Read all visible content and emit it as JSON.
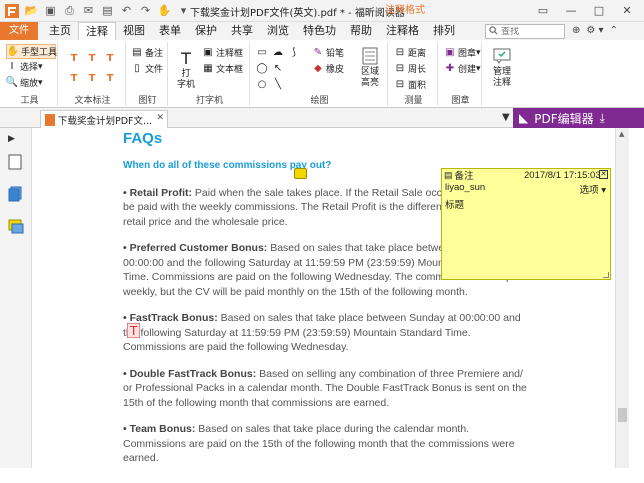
{
  "titlebar": {
    "title": "下载奖金计划PDF文件(英文).pdf * - 福昕阅读器",
    "context_tab": "注释格式"
  },
  "tabs": {
    "file": "文件",
    "items": [
      "主页",
      "注释",
      "视图",
      "表单",
      "保护",
      "共享",
      "浏览",
      "特色功",
      "帮助",
      "注释格",
      "排列"
    ],
    "active": "注释"
  },
  "search": {
    "placeholder": "查找"
  },
  "ribbon": {
    "tools": {
      "hand": "手型工具",
      "select": "选择",
      "zoom": "缩放",
      "group": "工具"
    },
    "textmark": {
      "group": "文本标注"
    },
    "pin": {
      "note": "备注",
      "file": "文件",
      "group": "图钉"
    },
    "typewriter": {
      "big": "打\n字机",
      "comment_box": "注释框",
      "text_box": "文本框",
      "group": "打字机"
    },
    "drawing": {
      "pencil": "铅笔",
      "eraser": "橡皮",
      "area_highlight": "区域\n高亮",
      "group": "绘图"
    },
    "measure": {
      "distance": "距离",
      "perimeter": "周长",
      "area": "面积",
      "group": "测量"
    },
    "stamp": {
      "stamp": "图章",
      "create": "创建",
      "group": "图章"
    },
    "manage": {
      "label": "管理\n注释"
    }
  },
  "doctab": {
    "name": "下载奖金计划PDF文..."
  },
  "pdf_editor": {
    "label": "PDF编辑器"
  },
  "doc": {
    "heading": "FAQs",
    "question": "When do all of these commissions pay out?",
    "paragraphs": [
      {
        "title": "Retail Profit:",
        "text": " Paid when the sale takes place. If the Retail Sale occurs in the Profit will be paid with the weekly commissions. The Retail Profit is the difference between the retail price and the wholesale price."
      },
      {
        "title": "Preferred Customer Bonus:",
        "text": " Based on sales that take place between Sunday at 00:00:00 and the following Saturday at 11:59:59 PM (23:59:59) Mountain Standard Time. Commissions are paid on the following Wednesday. The commission will be paid weekly, but the CV will be paid monthly on the 15th of the following month."
      },
      {
        "title": "FastTrack Bonus:",
        "text": " Based on sales that take place between Sunday at 00:00:00 and the following Saturday at 11:59:59 PM (23:59:59) Mountain Standard Time. Commissions are paid the following Wednesday."
      },
      {
        "title": "Double FastTrack Bonus:",
        "text": " Based on selling any combination of three Premiere and/ or Professional Packs in a calendar month. The Double FastTrack Bonus is sent on the 15th of the following month that commissions are earned."
      },
      {
        "title": "Team Bonus:",
        "text": " Based on sales that take place during the calendar month. Commissions are paid on the 15th of the following month that the commissions were earned."
      }
    ]
  },
  "note": {
    "label": "备注",
    "date": "2017/8/1 17:15:03",
    "author": "liyao_sun",
    "options": "选项",
    "body": "标题"
  }
}
